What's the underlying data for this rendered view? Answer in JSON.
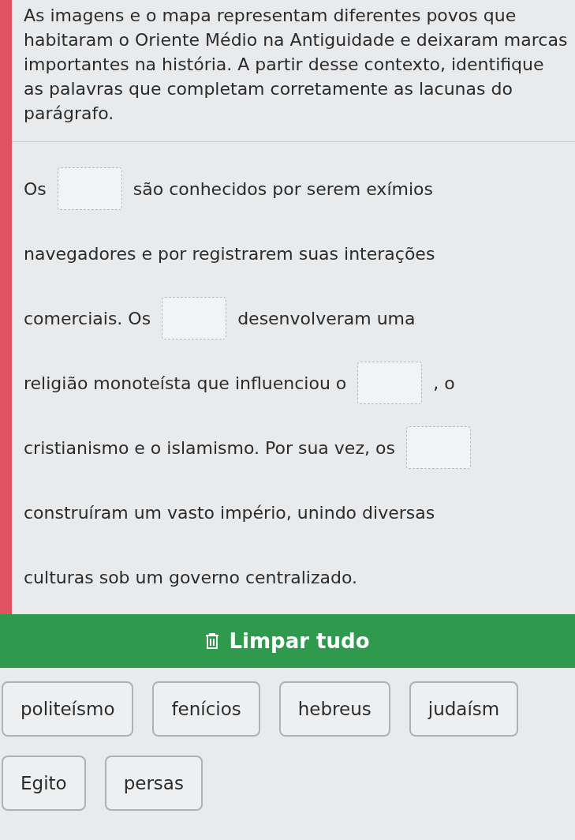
{
  "question": "As imagens e o mapa representam diferentes povos que habitaram o Oriente Médio na Antiguidade e deixaram marcas importantes na história. A partir desse contexto, identifique as palavras que completam corretamente as lacunas do parágrafo.",
  "paragraph_lines": [
    [
      {
        "kind": "text",
        "text": "Os"
      },
      {
        "kind": "blank"
      },
      {
        "kind": "text",
        "text": "são conhecidos por serem exímios"
      }
    ],
    [
      {
        "kind": "text",
        "text": "navegadores e por registrarem suas interações"
      }
    ],
    [
      {
        "kind": "text",
        "text": "comerciais. Os"
      },
      {
        "kind": "blank"
      },
      {
        "kind": "text",
        "text": "desenvolveram uma"
      }
    ],
    [
      {
        "kind": "text",
        "text": "religião monoteísta que influenciou o"
      },
      {
        "kind": "blank"
      },
      {
        "kind": "text",
        "text": ", o"
      }
    ],
    [
      {
        "kind": "text",
        "text": "cristianismo e o islamismo. Por sua vez, os"
      },
      {
        "kind": "blank"
      }
    ],
    [
      {
        "kind": "text",
        "text": "construíram um vasto império, unindo diversas"
      }
    ],
    [
      {
        "kind": "text",
        "text": "culturas sob um governo centralizado."
      }
    ]
  ],
  "clear_button": {
    "label": "Limpar tudo"
  },
  "word_bank": [
    {
      "label": "politeísmo"
    },
    {
      "label": "fenícios"
    },
    {
      "label": "hebreus"
    },
    {
      "label": "judaísm"
    },
    {
      "label": "Egito"
    },
    {
      "label": "persas"
    }
  ]
}
